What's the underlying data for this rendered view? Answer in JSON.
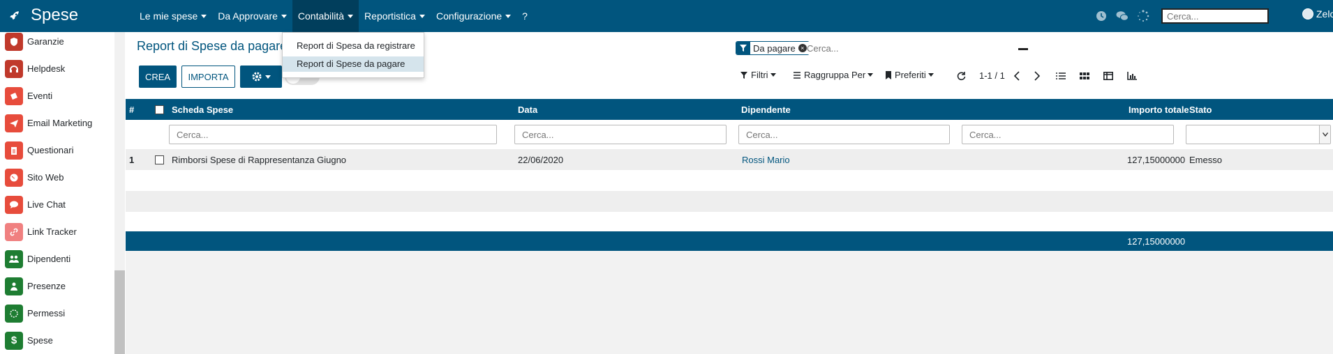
{
  "app": {
    "title": "Spese"
  },
  "menu": [
    {
      "label": "Le mie spese",
      "caret": true
    },
    {
      "label": "Da Approvare",
      "caret": true
    },
    {
      "label": "Contabilità",
      "caret": true,
      "active": true
    },
    {
      "label": "Reportistica",
      "caret": true
    },
    {
      "label": "Configurazione",
      "caret": true
    },
    {
      "label": "?",
      "caret": false
    }
  ],
  "systray": {
    "search_placeholder": "Cerca...",
    "user_name": "Zelo"
  },
  "dropdown": {
    "items": [
      {
        "label": "Report di Spesa da registrare",
        "highlighted": false
      },
      {
        "label": "Report di Spese da pagare",
        "highlighted": true
      }
    ]
  },
  "sidebar": {
    "items": [
      {
        "label": "Garanzie",
        "icon": "shield-icon",
        "color": "#c0392b"
      },
      {
        "label": "Helpdesk",
        "icon": "headset-icon",
        "color": "#c0392b"
      },
      {
        "label": "Eventi",
        "icon": "ticket-icon",
        "color": "#e74c3c"
      },
      {
        "label": "Email Marketing",
        "icon": "paper-plane-icon",
        "color": "#e74c3c"
      },
      {
        "label": "Questionari",
        "icon": "clipboard-icon",
        "color": "#e74c3c"
      },
      {
        "label": "Sito Web",
        "icon": "globe-icon",
        "color": "#e74c3c"
      },
      {
        "label": "Live Chat",
        "icon": "chat-icon",
        "color": "#e74c3c"
      },
      {
        "label": "Link Tracker",
        "icon": "link-icon",
        "color": "#f08080"
      },
      {
        "label": "Dipendenti",
        "icon": "users-icon",
        "color": "#1e7d32"
      },
      {
        "label": "Presenze",
        "icon": "user-icon",
        "color": "#1e7d32"
      },
      {
        "label": "Permessi",
        "icon": "circle-dots-icon",
        "color": "#1e7d32"
      },
      {
        "label": "Spese",
        "icon": "dollar-icon",
        "color": "#1e7d32"
      }
    ]
  },
  "page": {
    "title": "Report di Spese da pagare",
    "create_label": "CREA",
    "import_label": "IMPORTA"
  },
  "search": {
    "facet_value": "Da pagare",
    "placeholder": "Cerca..."
  },
  "controls": {
    "filters": "Filtri",
    "group_by": "Raggruppa Per",
    "favorites": "Preferiti",
    "pager": "1-1 / 1"
  },
  "table": {
    "headers": {
      "index": "#",
      "sheet": "Scheda Spese",
      "date": "Data",
      "employee": "Dipendente",
      "total": "Importo totale",
      "state": "Stato"
    },
    "filter_placeholder": "Cerca...",
    "rows": [
      {
        "index": "1",
        "sheet": "Rimborsi Spese di Rappresentanza Giugno",
        "date": "22/06/2020",
        "employee": "Rossi Mario",
        "total": "127,15000000",
        "state": "Emesso"
      }
    ],
    "footer_total": "127,15000000"
  },
  "colors": {
    "primary": "#01557e",
    "link": "#01557e"
  }
}
